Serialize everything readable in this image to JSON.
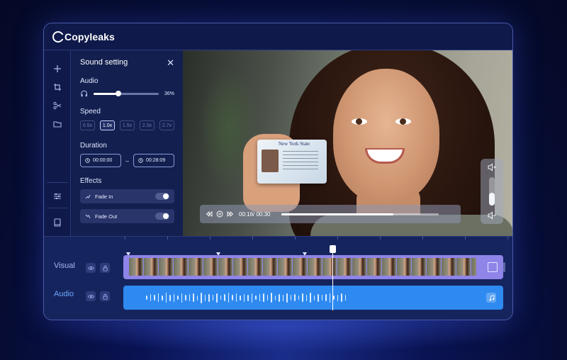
{
  "app": {
    "name": "Copyleaks"
  },
  "toolbar": {
    "tools": [
      "add-icon",
      "crop-icon",
      "scissors-icon",
      "folder-icon",
      "sliders-icon",
      "book-icon"
    ]
  },
  "panel": {
    "title": "Sound setting",
    "close_glyph": "✕",
    "audio": {
      "label": "Audio",
      "level_percent": 36,
      "level_text": "36%"
    },
    "speed": {
      "label": "Speed",
      "options": [
        "0.5x",
        "1.0x",
        "1.5x",
        "2.0x",
        "2.7x"
      ],
      "selected": "1.0x"
    },
    "duration": {
      "label": "Duration",
      "start": "00:00:00",
      "end": "00:28:09",
      "separator": "–"
    },
    "effects": {
      "label": "Effects",
      "items": [
        {
          "label": "Fade In",
          "enabled": true
        },
        {
          "label": "Fade Out",
          "enabled": true
        }
      ]
    }
  },
  "preview": {
    "id_card_title": "New York State",
    "player": {
      "time_text": "00:16/ 00:30",
      "progress_fraction": 0.71
    },
    "volume": {
      "level_fraction": 0.45
    }
  },
  "timeline": {
    "tracks": [
      {
        "label": "Visual",
        "color": "#8f84e8"
      },
      {
        "label": "Audio",
        "color": "#2e8af0"
      }
    ],
    "playhead_fraction": 0.55
  },
  "colors": {
    "accent": "#2e8af0",
    "visual_track": "#8f84e8",
    "app_bg": "#101b4e"
  }
}
